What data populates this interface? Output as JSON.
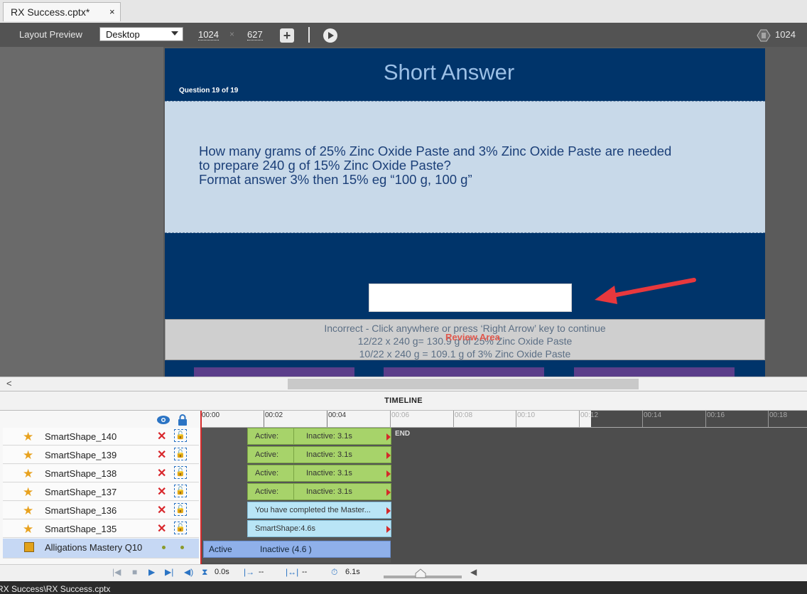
{
  "tab": {
    "title": "RX Success.cptx*",
    "close": "×"
  },
  "toolbar": {
    "layout_preview_label": "Layout Preview",
    "device": "Desktop",
    "width": "1024",
    "times": "×",
    "height": "627",
    "add_icon": "+",
    "breakpoint_value": "1024"
  },
  "slide": {
    "title": "Short Answer",
    "question_count": "Question 19 of 19",
    "question_lines": [
      "How many grams of 25% Zinc Oxide Paste and 3% Zinc Oxide Paste are needed",
      "to prepare 240 g of 15% Zinc Oxide Paste?",
      "Format answer 3% then 15% eg “100 g, 100 g”"
    ],
    "feedback_lines": [
      "Incorrect - Click anywhere or press ‘Right Arrow’ key to continue",
      "12/22 x 240 g= 130.9 g of 25% Zinc Oxide Paste",
      "10/22 x 240 g = 109.1 g of 3% Zinc Oxide Paste"
    ],
    "review_area_label": "Review Area",
    "arrow_color": "#e8383d"
  },
  "scroll": {
    "left_arrow": "<"
  },
  "timeline": {
    "header": "TIMELINE",
    "ruler_ticks": [
      "00:00",
      "00:02",
      "00:04",
      "00:06",
      "00:08",
      "00:10",
      "00:12",
      "00:14",
      "00:16",
      "00:18"
    ],
    "end_label": "END",
    "layers": [
      {
        "name": "SmartShape_140",
        "bar_type": "split",
        "active": "Active:",
        "inactive": "Inactive: 3.1s"
      },
      {
        "name": "SmartShape_139",
        "bar_type": "split",
        "active": "Active:",
        "inactive": "Inactive: 3.1s"
      },
      {
        "name": "SmartShape_138",
        "bar_type": "split",
        "active": "Active:",
        "inactive": "Inactive: 3.1s"
      },
      {
        "name": "SmartShape_137",
        "bar_type": "split",
        "active": "Active:",
        "inactive": "Inactive: 3.1s"
      },
      {
        "name": "SmartShape_136",
        "bar_type": "text",
        "text": "You have completed the Master..."
      },
      {
        "name": "SmartShape_135",
        "bar_type": "text",
        "text": "SmartShape:4.6s"
      }
    ],
    "slide_layer": {
      "name": "Alligations Mastery Q10",
      "active": "Active",
      "inactive": "Inactive (4.6 )"
    },
    "controls": {
      "current_time": "0.0s",
      "in_time": "--",
      "duration_in": "--",
      "total": "6.1s"
    }
  },
  "status": {
    "path": "RX Success\\RX Success.cptx"
  }
}
